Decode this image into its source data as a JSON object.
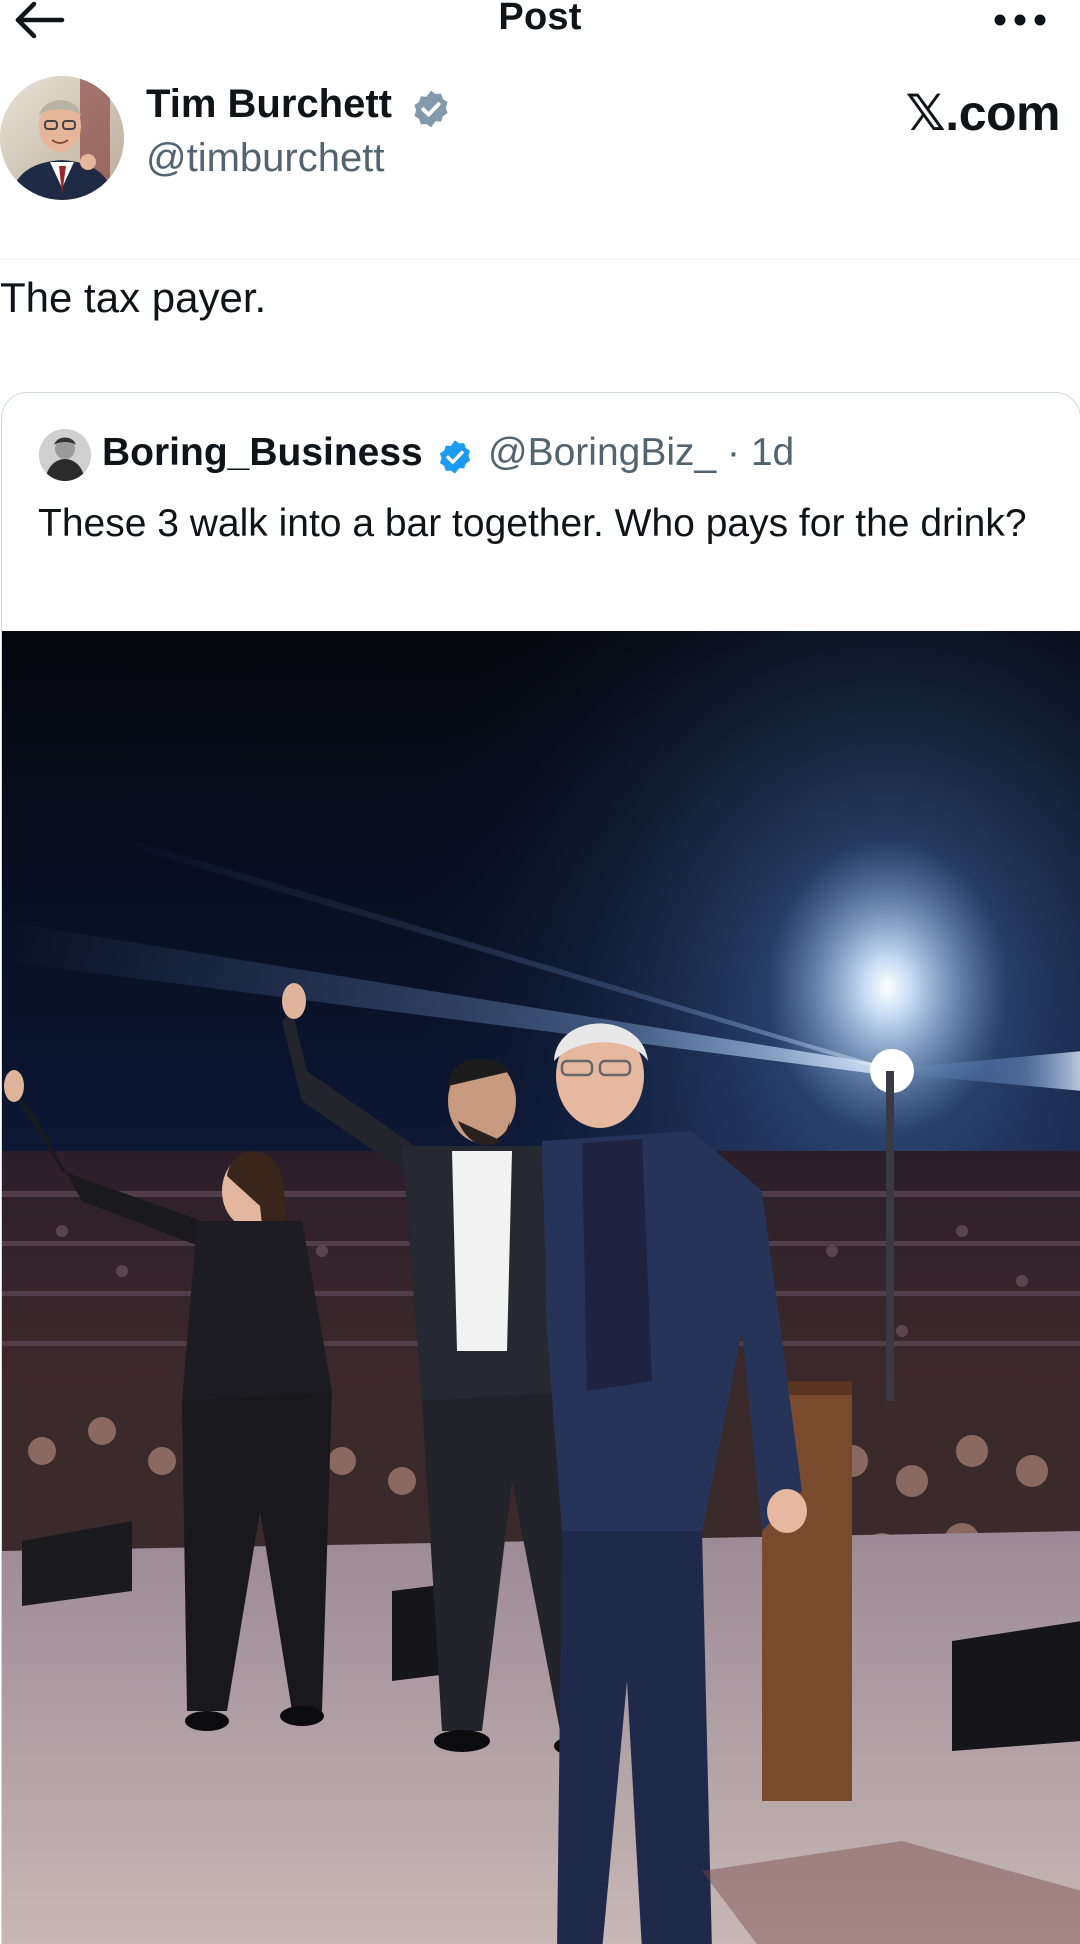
{
  "topbar": {
    "title": "Post",
    "back_icon": "arrow-left-icon",
    "more_icon": "more-horizontal-icon"
  },
  "post": {
    "author_name": "Tim Burchett",
    "author_handle": "@timburchett",
    "watermark": "𝕏.com",
    "text": "The tax payer.",
    "verified_icon": "verified-badge-icon"
  },
  "quote": {
    "author_name": "Boring_Business",
    "handle_time": "@BoringBiz_ · 1d",
    "text": "These 3 walk into a bar together. Who pays for the drink?",
    "verified_icon": "verified-badge-icon",
    "image_alt": "Three people waving on a stage in front of a large crowd at night"
  },
  "colors": {
    "text_primary": "#0f1419",
    "text_secondary": "#536471",
    "verified_blue": "#1d9bf0",
    "border": "#cfd9de"
  }
}
